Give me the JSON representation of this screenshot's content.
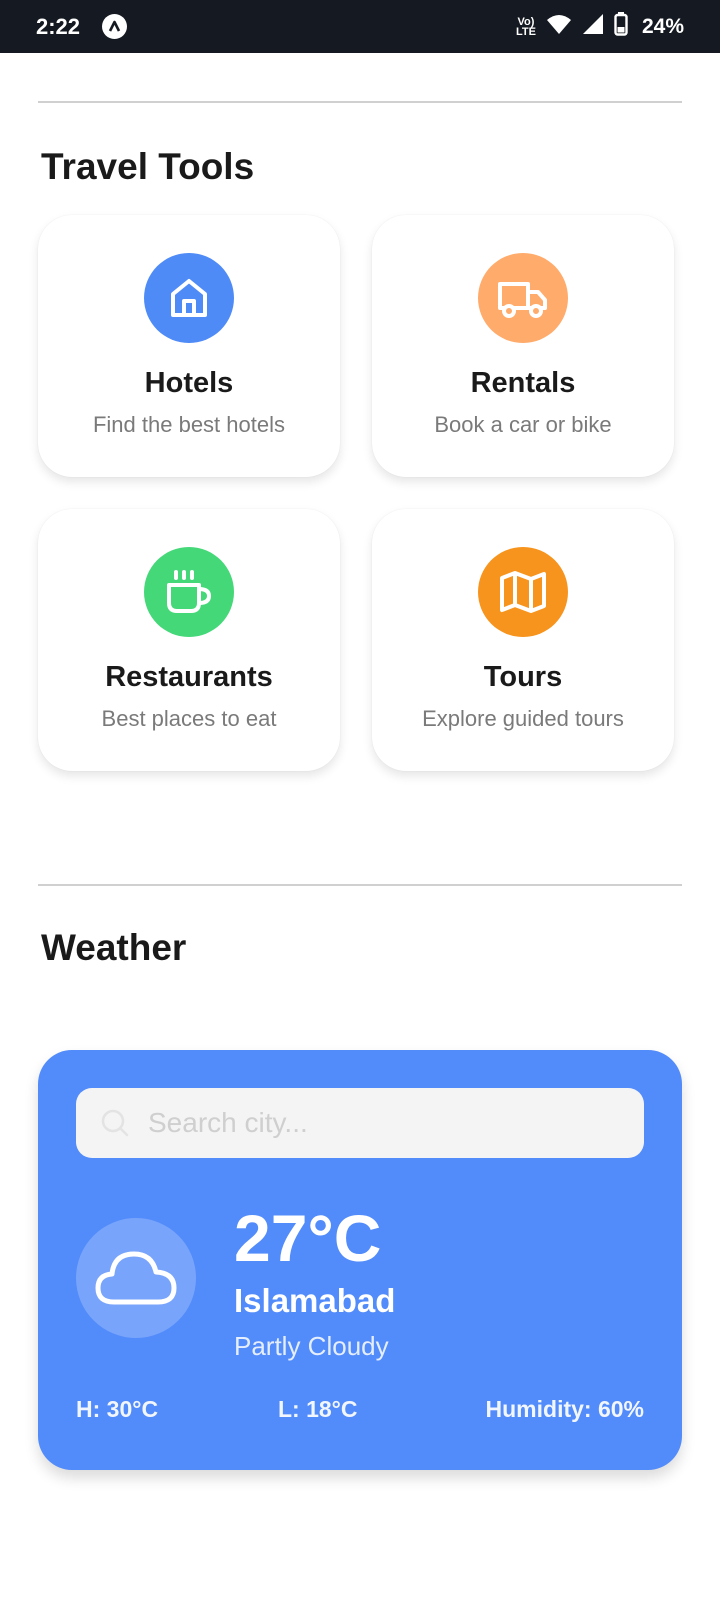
{
  "status_bar": {
    "time": "2:22",
    "network": "Vo)) LTE",
    "battery": "24%"
  },
  "travel_tools": {
    "title": "Travel Tools",
    "cards": [
      {
        "title": "Hotels",
        "subtitle": "Find the best hotels",
        "icon": "home-icon",
        "color": "#4f8bf7"
      },
      {
        "title": "Rentals",
        "subtitle": "Book a car or bike",
        "icon": "truck-icon",
        "color": "#ffab6b"
      },
      {
        "title": "Restaurants",
        "subtitle": "Best places to eat",
        "icon": "coffee-cup-icon",
        "color": "#45d879"
      },
      {
        "title": "Tours",
        "subtitle": "Explore guided tours",
        "icon": "map-icon",
        "color": "#f7941d"
      }
    ]
  },
  "weather": {
    "title": "Weather",
    "search_placeholder": "Search city...",
    "temperature": "27°C",
    "city": "Islamabad",
    "condition": "Partly Cloudy",
    "high": "H: 30°C",
    "low": "L: 18°C",
    "humidity": "Humidity: 60%",
    "card_color": "#528bfa"
  }
}
